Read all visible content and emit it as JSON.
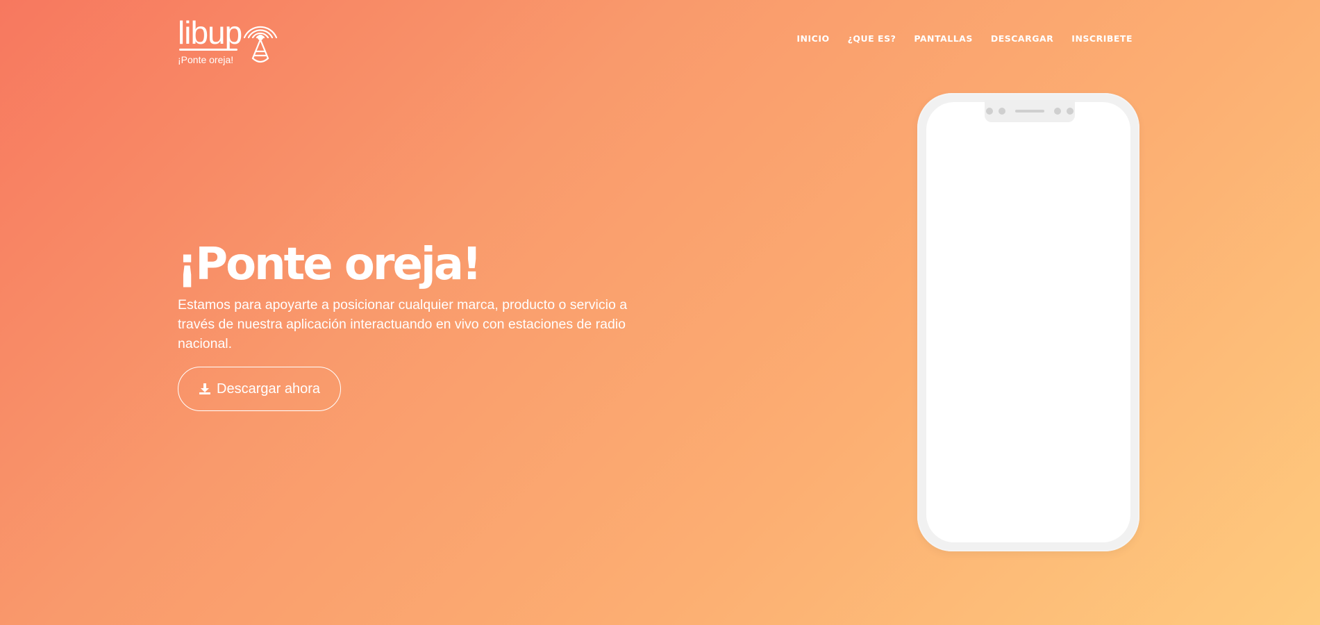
{
  "brand": {
    "name": "libup",
    "tagline": "¡Ponte oreja!"
  },
  "nav": {
    "items": [
      {
        "label": "INICIO"
      },
      {
        "label": "¿QUE ES?"
      },
      {
        "label": "PANTALLAS"
      },
      {
        "label": "DESCARGAR"
      },
      {
        "label": "INSCRIBETE"
      }
    ]
  },
  "hero": {
    "title": "¡Ponte oreja!",
    "description": "Estamos para apoyarte a posicionar cualquier marca, producto o servicio a través de nuestra aplicación interactuando en vivo con estaciones de radio nacional.",
    "cta_label": "Descargar ahora",
    "cta_icon": "download-icon"
  },
  "colors": {
    "gradient_start": "#f7785f",
    "gradient_end": "#fecb7e",
    "text": "#ffffff",
    "phone_frame": "#f1f1f1"
  }
}
